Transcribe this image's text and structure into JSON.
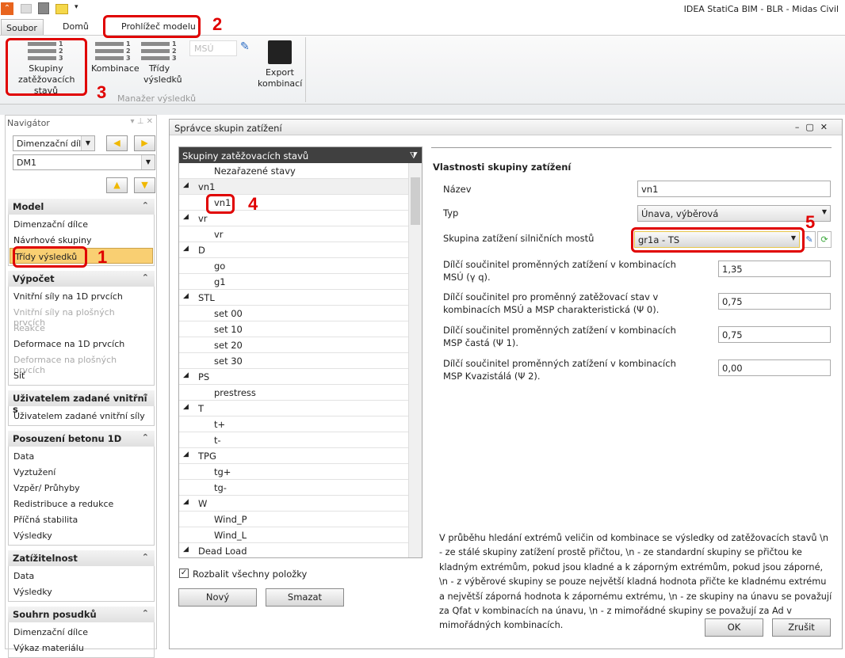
{
  "app": {
    "title": "IDEA StatiCa BIM - BLR - Midas Civil"
  },
  "tabs": [
    "Soubor",
    "Domů",
    "Prohlížeč modelu"
  ],
  "ribbon": {
    "buttons": [
      "Skupiny zatěžovacích stavů",
      "Kombinace",
      "Třídy výsledků",
      "Export kombinací"
    ],
    "msu_placeholder": "MSÚ",
    "group_label": "Manažer výsledků"
  },
  "navigator": {
    "title": "Navigátor",
    "type_select": "Dimenzační dílec",
    "member_select": "DM1",
    "sections": [
      {
        "title": "Model",
        "items": [
          {
            "label": "Dimenzační dílce"
          },
          {
            "label": "Návrhové skupiny"
          },
          {
            "label": "Třídy výsledků",
            "active": true
          }
        ]
      },
      {
        "title": "Výpočet",
        "items": [
          {
            "label": "Vnitřní síly na 1D prvcích"
          },
          {
            "label": "Vnitřní síly na plošných prvcích",
            "disabled": true
          },
          {
            "label": "Reakce",
            "disabled": true
          },
          {
            "label": "Deformace na 1D prvcích"
          },
          {
            "label": "Deformace na plošných prvcích",
            "disabled": true
          },
          {
            "label": "Síť"
          }
        ]
      },
      {
        "title": "Uživatelem zadané vnitřní s",
        "items": [
          {
            "label": "Uživatelem zadané vnitřní síly"
          }
        ]
      },
      {
        "title": "Posouzení betonu 1D",
        "items": [
          {
            "label": "Data"
          },
          {
            "label": "Vyztužení"
          },
          {
            "label": "Vzpěr/ Průhyby"
          },
          {
            "label": "Redistribuce a redukce"
          },
          {
            "label": "Příčná stabilita"
          },
          {
            "label": "Výsledky"
          }
        ]
      },
      {
        "title": "Zatížitelnost",
        "items": [
          {
            "label": "Data"
          },
          {
            "label": "Výsledky"
          }
        ]
      },
      {
        "title": "Souhrn posudků",
        "items": [
          {
            "label": "Dimenzační dílce"
          },
          {
            "label": "Výkaz materiálu"
          }
        ]
      }
    ]
  },
  "dialog": {
    "title": "Správce skupin zatížení",
    "tree": {
      "header": "Skupiny zatěžovacích stavů",
      "rows": [
        {
          "label": "Nezařazené stavy",
          "level": 1
        },
        {
          "label": "vn1",
          "level": 0
        },
        {
          "label": "vn1",
          "level": 1,
          "selected": true
        },
        {
          "label": "vr",
          "level": 0
        },
        {
          "label": "vr",
          "level": 1
        },
        {
          "label": "D",
          "level": 0
        },
        {
          "label": "go",
          "level": 1
        },
        {
          "label": "g1",
          "level": 1
        },
        {
          "label": "STL",
          "level": 0
        },
        {
          "label": "set 00",
          "level": 1
        },
        {
          "label": "set 10",
          "level": 1
        },
        {
          "label": "set 20",
          "level": 1
        },
        {
          "label": "set 30",
          "level": 1
        },
        {
          "label": "PS",
          "level": 0
        },
        {
          "label": "prestress",
          "level": 1
        },
        {
          "label": "T",
          "level": 0
        },
        {
          "label": "t+",
          "level": 1
        },
        {
          "label": "t-",
          "level": 1
        },
        {
          "label": "TPG",
          "level": 0
        },
        {
          "label": "tg+",
          "level": 1
        },
        {
          "label": "tg-",
          "level": 1
        },
        {
          "label": "W",
          "level": 0
        },
        {
          "label": "Wind_P",
          "level": 1
        },
        {
          "label": "Wind_L",
          "level": 1
        },
        {
          "label": "Dead Load",
          "level": 0
        }
      ]
    },
    "expand_all": "Rozbalit všechny položky",
    "new_btn": "Nový",
    "delete_btn": "Smazat",
    "props": {
      "heading": "Vlastnosti skupiny zatížení",
      "name_label": "Název",
      "name_value": "vn1",
      "type_label": "Typ",
      "type_value": "Únava, výběrová",
      "bridge_label": "Skupina zatížení silničních mostů",
      "bridge_value": "gr1a - TS",
      "f1_label": "Dílčí součinitel proměnných zatížení v kombinacích MSÚ (γ q).",
      "f1_value": "1,35",
      "f2_label": "Dílčí součinitel pro proměnný zatěžovací stav v kombinacích MSÚ a MSP charakteristická (Ψ 0).",
      "f2_value": "0,75",
      "f3_label": "Dílčí součinitel proměnných zatížení v kombinacích MSP častá  (Ψ 1).",
      "f3_value": "0,75",
      "f4_label": "Dílčí součinitel proměnných zatížení v kombinacích MSP Kvazistálá  (Ψ 2).",
      "f4_value": "0,00"
    },
    "description": "V průběhu hledání extrémů veličin od kombinace se výsledky od zatěžovacích stavů \\n - ze stálé skupiny zatížení prostě přičtou, \\n - ze standardní skupiny se přičtou ke kladným extrémům, pokud jsou kladné a k záporným extrémům, pokud jsou záporné,  \\n - z výběrové skupiny se pouze největší kladná hodnota přičte ke kladnému extrému a největší záporná hodnota k zápornému extrému, \\n - ze skupiny na únavu se považují za Qfat v kombinacích na únavu, \\n - z mimořádné skupiny se považují za Ad v mimořádných kombinacích.",
    "ok": "OK",
    "cancel": "Zrušit"
  },
  "annotations": [
    "1",
    "2",
    "3",
    "4",
    "5"
  ]
}
